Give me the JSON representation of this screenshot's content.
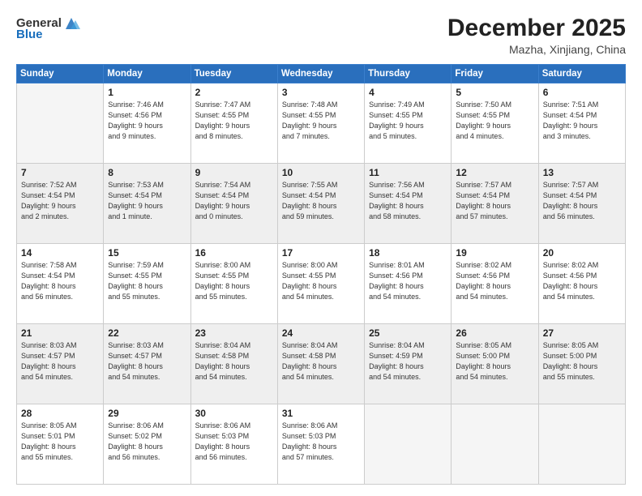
{
  "header": {
    "logo_general": "General",
    "logo_blue": "Blue",
    "month": "December 2025",
    "location": "Mazha, Xinjiang, China"
  },
  "weekdays": [
    "Sunday",
    "Monday",
    "Tuesday",
    "Wednesday",
    "Thursday",
    "Friday",
    "Saturday"
  ],
  "weeks": [
    [
      {
        "day": "",
        "info": ""
      },
      {
        "day": "1",
        "info": "Sunrise: 7:46 AM\nSunset: 4:56 PM\nDaylight: 9 hours\nand 9 minutes."
      },
      {
        "day": "2",
        "info": "Sunrise: 7:47 AM\nSunset: 4:55 PM\nDaylight: 9 hours\nand 8 minutes."
      },
      {
        "day": "3",
        "info": "Sunrise: 7:48 AM\nSunset: 4:55 PM\nDaylight: 9 hours\nand 7 minutes."
      },
      {
        "day": "4",
        "info": "Sunrise: 7:49 AM\nSunset: 4:55 PM\nDaylight: 9 hours\nand 5 minutes."
      },
      {
        "day": "5",
        "info": "Sunrise: 7:50 AM\nSunset: 4:55 PM\nDaylight: 9 hours\nand 4 minutes."
      },
      {
        "day": "6",
        "info": "Sunrise: 7:51 AM\nSunset: 4:54 PM\nDaylight: 9 hours\nand 3 minutes."
      }
    ],
    [
      {
        "day": "7",
        "info": "Sunrise: 7:52 AM\nSunset: 4:54 PM\nDaylight: 9 hours\nand 2 minutes."
      },
      {
        "day": "8",
        "info": "Sunrise: 7:53 AM\nSunset: 4:54 PM\nDaylight: 9 hours\nand 1 minute."
      },
      {
        "day": "9",
        "info": "Sunrise: 7:54 AM\nSunset: 4:54 PM\nDaylight: 9 hours\nand 0 minutes."
      },
      {
        "day": "10",
        "info": "Sunrise: 7:55 AM\nSunset: 4:54 PM\nDaylight: 8 hours\nand 59 minutes."
      },
      {
        "day": "11",
        "info": "Sunrise: 7:56 AM\nSunset: 4:54 PM\nDaylight: 8 hours\nand 58 minutes."
      },
      {
        "day": "12",
        "info": "Sunrise: 7:57 AM\nSunset: 4:54 PM\nDaylight: 8 hours\nand 57 minutes."
      },
      {
        "day": "13",
        "info": "Sunrise: 7:57 AM\nSunset: 4:54 PM\nDaylight: 8 hours\nand 56 minutes."
      }
    ],
    [
      {
        "day": "14",
        "info": "Sunrise: 7:58 AM\nSunset: 4:54 PM\nDaylight: 8 hours\nand 56 minutes."
      },
      {
        "day": "15",
        "info": "Sunrise: 7:59 AM\nSunset: 4:55 PM\nDaylight: 8 hours\nand 55 minutes."
      },
      {
        "day": "16",
        "info": "Sunrise: 8:00 AM\nSunset: 4:55 PM\nDaylight: 8 hours\nand 55 minutes."
      },
      {
        "day": "17",
        "info": "Sunrise: 8:00 AM\nSunset: 4:55 PM\nDaylight: 8 hours\nand 54 minutes."
      },
      {
        "day": "18",
        "info": "Sunrise: 8:01 AM\nSunset: 4:56 PM\nDaylight: 8 hours\nand 54 minutes."
      },
      {
        "day": "19",
        "info": "Sunrise: 8:02 AM\nSunset: 4:56 PM\nDaylight: 8 hours\nand 54 minutes."
      },
      {
        "day": "20",
        "info": "Sunrise: 8:02 AM\nSunset: 4:56 PM\nDaylight: 8 hours\nand 54 minutes."
      }
    ],
    [
      {
        "day": "21",
        "info": "Sunrise: 8:03 AM\nSunset: 4:57 PM\nDaylight: 8 hours\nand 54 minutes."
      },
      {
        "day": "22",
        "info": "Sunrise: 8:03 AM\nSunset: 4:57 PM\nDaylight: 8 hours\nand 54 minutes."
      },
      {
        "day": "23",
        "info": "Sunrise: 8:04 AM\nSunset: 4:58 PM\nDaylight: 8 hours\nand 54 minutes."
      },
      {
        "day": "24",
        "info": "Sunrise: 8:04 AM\nSunset: 4:58 PM\nDaylight: 8 hours\nand 54 minutes."
      },
      {
        "day": "25",
        "info": "Sunrise: 8:04 AM\nSunset: 4:59 PM\nDaylight: 8 hours\nand 54 minutes."
      },
      {
        "day": "26",
        "info": "Sunrise: 8:05 AM\nSunset: 5:00 PM\nDaylight: 8 hours\nand 54 minutes."
      },
      {
        "day": "27",
        "info": "Sunrise: 8:05 AM\nSunset: 5:00 PM\nDaylight: 8 hours\nand 55 minutes."
      }
    ],
    [
      {
        "day": "28",
        "info": "Sunrise: 8:05 AM\nSunset: 5:01 PM\nDaylight: 8 hours\nand 55 minutes."
      },
      {
        "day": "29",
        "info": "Sunrise: 8:06 AM\nSunset: 5:02 PM\nDaylight: 8 hours\nand 56 minutes."
      },
      {
        "day": "30",
        "info": "Sunrise: 8:06 AM\nSunset: 5:03 PM\nDaylight: 8 hours\nand 56 minutes."
      },
      {
        "day": "31",
        "info": "Sunrise: 8:06 AM\nSunset: 5:03 PM\nDaylight: 8 hours\nand 57 minutes."
      },
      {
        "day": "",
        "info": ""
      },
      {
        "day": "",
        "info": ""
      },
      {
        "day": "",
        "info": ""
      }
    ]
  ]
}
